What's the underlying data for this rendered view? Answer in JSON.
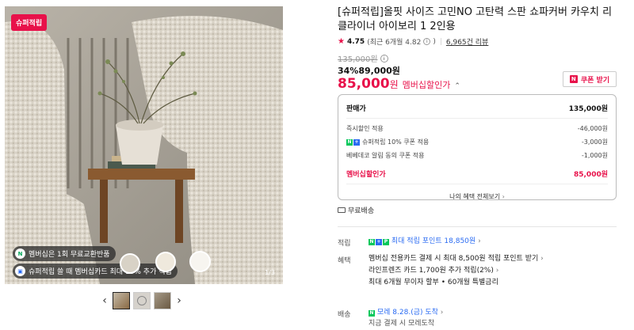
{
  "gallery": {
    "badge": "슈퍼적립",
    "counter": "1/3",
    "promo_1": "멤버십은 1회 무료교환반품",
    "promo_2": "슈퍼적립 쓸 때 멤버십카드 최대 10% 추가 적립"
  },
  "product": {
    "title": "[슈퍼적립]올핏 사이즈 고민NO 고탄력 스판 쇼파커버 카우치 리클라이너 아이보리 1 2인용",
    "rating_score": "4.75",
    "rating_note": "(최근 6개월 4.82",
    "review_count": "6,965건 리뷰",
    "original_price": "135,000원",
    "discount_percent": "34%",
    "discount_price": "89,000원",
    "member_price": "85,000",
    "member_price_unit": "원",
    "member_label": "멤버십할인가",
    "coupon_button": "쿠폰 받기"
  },
  "breakdown": {
    "head_label": "판매가",
    "head_value": "135,000원",
    "rows": [
      {
        "label": "즉시할인 적용",
        "value": "-46,000원"
      },
      {
        "label": "슈퍼적립 10% 쿠폰 적용",
        "value": "-3,000원"
      },
      {
        "label": "베베데코 알림 동의 쿠폰 적용",
        "value": "-1,000원"
      }
    ],
    "final_label": "멤버십할인가",
    "final_value": "85,000원",
    "see_all": "나의 혜택 전체보기"
  },
  "shipping": {
    "free": "무료배송"
  },
  "details": {
    "points_label": "적립",
    "points_text": "최대 적립 포인트 18,850원",
    "benefits_label": "혜택",
    "benefits": [
      "멤버십 전용카드 결제 시 최대 8,500원 적립 포인트 받기",
      "라인프렌즈 카드 1,700원 추가 적립(2%)",
      "최대 6개월 무이자 할부 • 60개월 특별금리"
    ],
    "delivery_label": "배송",
    "delivery_text": "모레 8.28.(금) 도착",
    "delivery_sub": "지금 결제 시 모레도착"
  }
}
